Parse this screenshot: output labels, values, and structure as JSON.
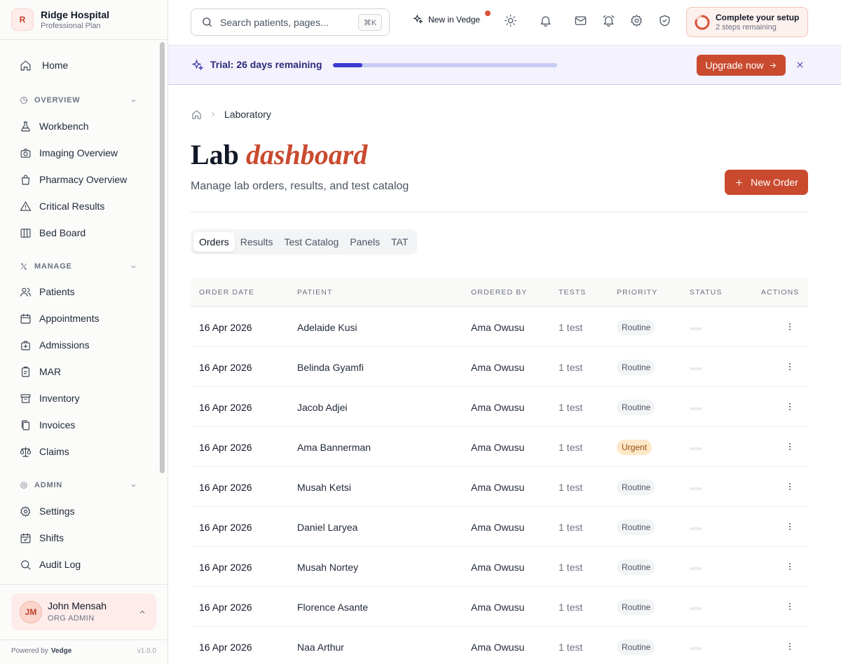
{
  "brand": {
    "logo_letter": "R",
    "name": "Ridge Hospital",
    "plan": "Professional Plan"
  },
  "sidebar": {
    "home": "Home",
    "sections": [
      {
        "label": "OVERVIEW",
        "items": [
          "Workbench",
          "Imaging Overview",
          "Pharmacy Overview",
          "Critical Results",
          "Bed Board"
        ]
      },
      {
        "label": "MANAGE",
        "items": [
          "Patients",
          "Appointments",
          "Admissions",
          "MAR",
          "Inventory",
          "Invoices",
          "Claims"
        ]
      },
      {
        "label": "ADMIN",
        "items": [
          "Settings",
          "Shifts",
          "Audit Log"
        ]
      }
    ],
    "user": {
      "initials": "JM",
      "name": "John Mensah",
      "role": "ORG ADMIN"
    },
    "powered_by_label": "Powered by",
    "powered_by_brand": "Vedge",
    "version": "v1.0.0"
  },
  "topbar": {
    "search_placeholder": "Search patients, pages...",
    "search_shortcut": "⌘K",
    "new_in": "New in Vedge",
    "setup_title": "Complete your setup",
    "setup_sub": "2 steps remaining"
  },
  "banner": {
    "text": "Trial: 26 days remaining",
    "progress_percent": 13,
    "upgrade_label": "Upgrade now"
  },
  "page": {
    "breadcrumb": "Laboratory",
    "title_plain": "Lab",
    "title_accent": "dashboard",
    "subtitle": "Manage lab orders, results, and test catalog",
    "new_order_label": "New Order",
    "tabs": [
      "Orders",
      "Results",
      "Test Catalog",
      "Panels",
      "TAT"
    ],
    "active_tab": "Orders"
  },
  "table": {
    "headers": [
      "ORDER DATE",
      "PATIENT",
      "ORDERED BY",
      "TESTS",
      "PRIORITY",
      "STATUS",
      "ACTIONS"
    ],
    "rows": [
      {
        "date": "16 Apr 2026",
        "patient": "Adelaide Kusi",
        "ordered_by": "Ama Owusu",
        "tests": "1 test",
        "priority": "Routine"
      },
      {
        "date": "16 Apr 2026",
        "patient": "Belinda Gyamfi",
        "ordered_by": "Ama Owusu",
        "tests": "1 test",
        "priority": "Routine"
      },
      {
        "date": "16 Apr 2026",
        "patient": "Jacob Adjei",
        "ordered_by": "Ama Owusu",
        "tests": "1 test",
        "priority": "Routine"
      },
      {
        "date": "16 Apr 2026",
        "patient": "Ama Bannerman",
        "ordered_by": "Ama Owusu",
        "tests": "1 test",
        "priority": "Urgent"
      },
      {
        "date": "16 Apr 2026",
        "patient": "Musah Ketsi",
        "ordered_by": "Ama Owusu",
        "tests": "1 test",
        "priority": "Routine"
      },
      {
        "date": "16 Apr 2026",
        "patient": "Daniel Laryea",
        "ordered_by": "Ama Owusu",
        "tests": "1 test",
        "priority": "Routine"
      },
      {
        "date": "16 Apr 2026",
        "patient": "Musah Nortey",
        "ordered_by": "Ama Owusu",
        "tests": "1 test",
        "priority": "Routine"
      },
      {
        "date": "16 Apr 2026",
        "patient": "Florence Asante",
        "ordered_by": "Ama Owusu",
        "tests": "1 test",
        "priority": "Routine"
      },
      {
        "date": "16 Apr 2026",
        "patient": "Naa Arthur",
        "ordered_by": "Ama Owusu",
        "tests": "1 test",
        "priority": "Routine"
      }
    ]
  },
  "colors": {
    "accent": "#c94a2f",
    "banner_bg": "#f3f2fd",
    "progress": "#3b3bd1",
    "urgent_bg": "#fde8c8"
  }
}
